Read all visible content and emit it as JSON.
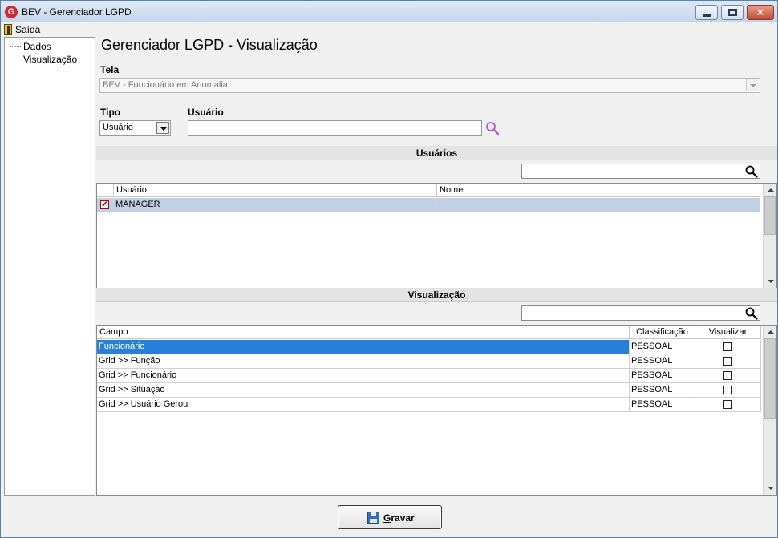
{
  "window": {
    "title": "BEV - Gerenciador LGPD",
    "logo_letter": "G"
  },
  "menu": {
    "exit_label": "Saída"
  },
  "sidebar": {
    "items": [
      {
        "label": "Dados"
      },
      {
        "label": "Visualização"
      }
    ]
  },
  "page": {
    "title": "Gerenciador LGPD - Visualização"
  },
  "form": {
    "tela_label": "Tela",
    "tela_value": "BEV - Funcionário em Anomalia",
    "tipo_label": "Tipo",
    "tipo_value": "Usuário",
    "usuario_label": "Usuário",
    "usuario_value": ""
  },
  "usuarios_section": {
    "title": "Usuários",
    "filter_value": "",
    "columns": [
      "Usuário",
      "Nome"
    ],
    "rows": [
      {
        "checked": true,
        "usuario": "MANAGER",
        "nome": ""
      }
    ]
  },
  "visualizacao_section": {
    "title": "Visualização",
    "filter_value": "",
    "columns": [
      "Campo",
      "Classificação",
      "Visualizar"
    ],
    "rows": [
      {
        "campo": "Funcionário",
        "classificacao": "PESSOAL",
        "visualizar": false
      },
      {
        "campo": "Grid >> Função",
        "classificacao": "PESSOAL",
        "visualizar": false
      },
      {
        "campo": "Grid >> Funcionário",
        "classificacao": "PESSOAL",
        "visualizar": false
      },
      {
        "campo": "Grid >> Situação",
        "classificacao": "PESSOAL",
        "visualizar": false
      },
      {
        "campo": "Grid >> Usuário Gerou",
        "classificacao": "PESSOAL",
        "visualizar": false
      }
    ]
  },
  "buttons": {
    "save_label": "Gravar",
    "save_accel": "G",
    "save_rest": "ravar"
  },
  "colors": {
    "selection_blue": "#2680d9",
    "selection_grey": "#c3cfe5",
    "search_icon": "#b85fd0"
  }
}
